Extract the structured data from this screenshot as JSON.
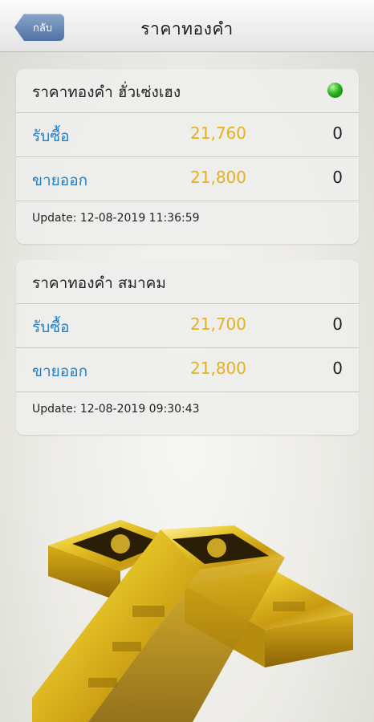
{
  "navbar": {
    "back_label": "กลับ",
    "title": "ราคาทองคำ"
  },
  "cards": [
    {
      "title": "ราคาทองคำ ฮั่วเซ่งเฮง",
      "status": "green",
      "buy": {
        "label": "รับซื้อ",
        "price": "21,760",
        "change": "0"
      },
      "sell": {
        "label": "ขายออก",
        "price": "21,800",
        "change": "0"
      },
      "update": "Update: 12-08-2019 11:36:59"
    },
    {
      "title": "ราคาทองคำ สมาคม",
      "buy": {
        "label": "รับซื้อ",
        "price": "21,700",
        "change": "0"
      },
      "sell": {
        "label": "ขายออก",
        "price": "21,800",
        "change": "0"
      },
      "update": "Update: 12-08-2019 09:30:43"
    }
  ],
  "colors": {
    "label_blue": "#1f7fc8",
    "price_gold": "#e3b21c",
    "status_green": "#2fb41f"
  },
  "illustration": {
    "name": "gold-bars-icon"
  }
}
